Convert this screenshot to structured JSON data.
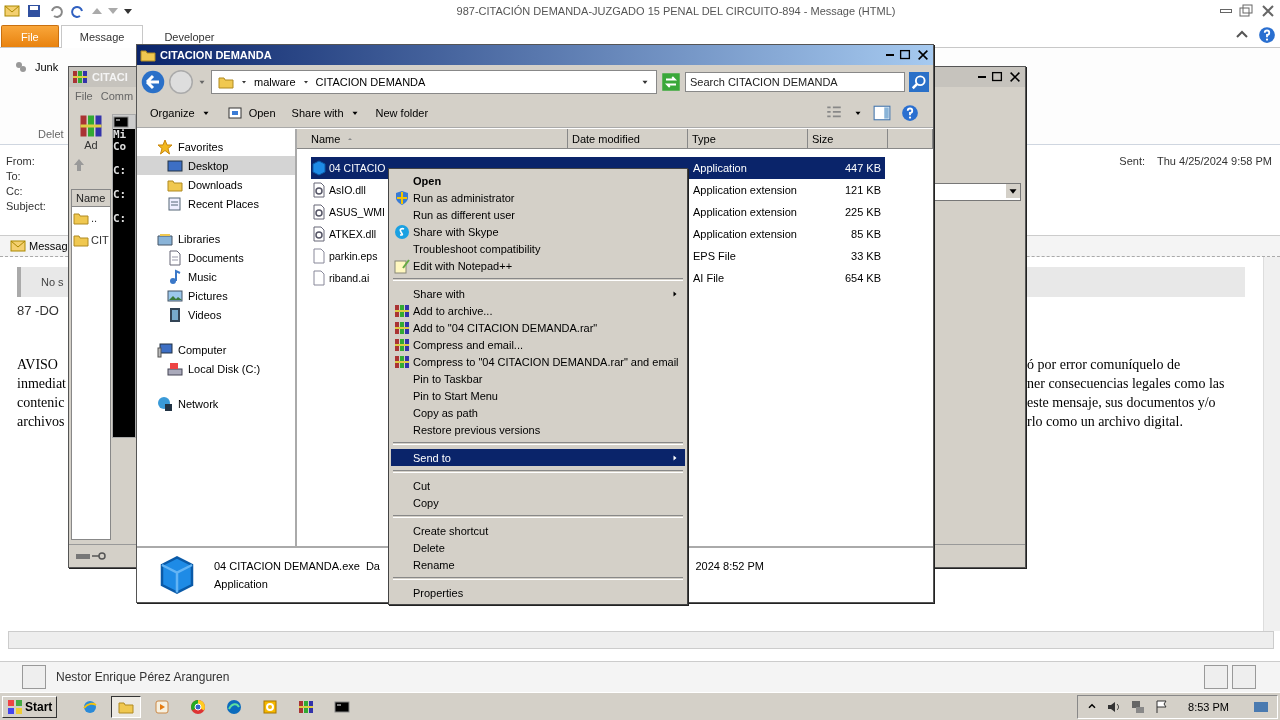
{
  "outlook": {
    "title": "987-CITACIÓN  DEMANDA-JUZGADO 15 PENAL DEL CIRCUITO-894 -  Message (HTML)",
    "tabs": [
      {
        "label": "File",
        "kind": "file",
        "selected": false
      },
      {
        "label": "Message",
        "kind": "tab",
        "selected": true
      },
      {
        "label": "Developer",
        "kind": "tab",
        "selected": false
      }
    ],
    "junk": "Junk",
    "group_label": "Delet",
    "headers": [
      "From:",
      "To:",
      "Cc:",
      "Subject:"
    ],
    "sent_label": "Sent:",
    "sent_value": "Thu 4/25/2024 9:58 PM",
    "attachment": "Messag",
    "info_bar": "No s",
    "first_line": "87 -DO",
    "body_left": [
      "AVISO",
      "inmediat",
      "contenic",
      "archivos"
    ],
    "body_right": [
      "ó por error comuníquelo de",
      "ner consecuencias legales como las",
      "este mensaje, sus documentos y/o",
      "rlo como un archivo digital."
    ],
    "people": "Nestor Enrique Pérez Aranguren"
  },
  "winrar": {
    "title": "CITACI",
    "menu": [
      "File",
      "Comm"
    ],
    "tool": "Ad",
    "column": "Name",
    "rows": [
      "..",
      "CIT"
    ]
  },
  "console": {
    "lines": [
      "Mi",
      "Co",
      "C:",
      "C:",
      "C:"
    ]
  },
  "explorer": {
    "title": "CITACION DEMANDA",
    "path": [
      "malware",
      "CITACION DEMANDA"
    ],
    "search": {
      "placeholder": "Search CITACION DEMANDA"
    },
    "toolbar": [
      {
        "label": "Organize",
        "kind": "menu"
      },
      {
        "label": "Open",
        "kind": "open"
      },
      {
        "label": "Share with",
        "kind": "menu"
      },
      {
        "label": "New folder",
        "kind": "plain"
      }
    ],
    "nav": [
      {
        "label": "Favorites",
        "kind": "star",
        "selected": false,
        "children": [
          {
            "label": "Desktop",
            "kind": "desktop",
            "selected": true
          },
          {
            "label": "Downloads",
            "kind": "folder",
            "selected": false
          },
          {
            "label": "Recent Places",
            "kind": "recent",
            "selected": false
          }
        ]
      },
      {
        "label": "Libraries",
        "kind": "library",
        "selected": false,
        "children": [
          {
            "label": "Documents",
            "kind": "document",
            "selected": false
          },
          {
            "label": "Music",
            "kind": "music",
            "selected": false
          },
          {
            "label": "Pictures",
            "kind": "picture",
            "selected": false
          },
          {
            "label": "Videos",
            "kind": "video",
            "selected": false
          }
        ]
      },
      {
        "label": "Computer",
        "kind": "computer",
        "selected": false,
        "children": [
          {
            "label": "Local Disk (C:)",
            "kind": "disk",
            "selected": false
          }
        ]
      },
      {
        "label": "Network",
        "kind": "network",
        "selected": false
      }
    ],
    "columns": [
      "Name",
      "Date modified",
      "Type",
      "Size"
    ],
    "rows": [
      {
        "name": "04 CITACIO",
        "kind": "exe",
        "type": "Application",
        "size": "447 KB",
        "selected": true
      },
      {
        "name": "AsIO.dll",
        "kind": "dll",
        "type": "Application extension",
        "size": "121 KB",
        "selected": false
      },
      {
        "name": "ASUS_WMI",
        "kind": "dll",
        "type": "Application extension",
        "size": "225 KB",
        "selected": false
      },
      {
        "name": "ATKEX.dll",
        "kind": "dll",
        "type": "Application extension",
        "size": "85 KB",
        "selected": false
      },
      {
        "name": "parkin.eps",
        "kind": "file",
        "type": "EPS File",
        "size": "33 KB",
        "selected": false
      },
      {
        "name": "riband.ai",
        "kind": "file",
        "type": "AI File",
        "size": "654 KB",
        "selected": false
      }
    ],
    "details": {
      "name": "04 CITACION DEMANDA.exe",
      "label": "Da",
      "date": "2024 8:52 PM",
      "type": "Application"
    }
  },
  "menu": [
    {
      "label": "Open",
      "kind": "default",
      "selected": false
    },
    {
      "label": "Run as administrator",
      "kind": "shield",
      "selected": false
    },
    {
      "label": "Run as different user",
      "kind": "item",
      "selected": false
    },
    {
      "label": "Share with Skype",
      "kind": "chat",
      "selected": false
    },
    {
      "label": "Troubleshoot compatibility",
      "kind": "item",
      "selected": false
    },
    {
      "label": "Edit with Notepad++",
      "kind": "notepad",
      "selected": false
    },
    {
      "kind": "separator"
    },
    {
      "label": "Share with",
      "kind": "submenu",
      "selected": false
    },
    {
      "label": "Add to archive...",
      "kind": "archive",
      "selected": false
    },
    {
      "label": "Add to \"04 CITACION DEMANDA.rar\"",
      "kind": "archive",
      "selected": false
    },
    {
      "label": "Compress and email...",
      "kind": "archive",
      "selected": false
    },
    {
      "label": "Compress to \"04 CITACION DEMANDA.rar\" and email",
      "kind": "archive",
      "selected": false
    },
    {
      "label": "Pin to Taskbar",
      "kind": "item",
      "selected": false
    },
    {
      "label": "Pin to Start Menu",
      "kind": "item",
      "selected": false
    },
    {
      "label": "Copy as path",
      "kind": "item",
      "selected": false
    },
    {
      "label": "Restore previous versions",
      "kind": "item",
      "selected": false
    },
    {
      "kind": "separator"
    },
    {
      "label": "Send to",
      "kind": "submenu",
      "selected": true
    },
    {
      "kind": "separator"
    },
    {
      "label": "Cut",
      "kind": "item",
      "selected": false
    },
    {
      "label": "Copy",
      "kind": "item",
      "selected": false
    },
    {
      "kind": "separator"
    },
    {
      "label": "Create shortcut",
      "kind": "item",
      "selected": false
    },
    {
      "label": "Delete",
      "kind": "item",
      "selected": false
    },
    {
      "label": "Rename",
      "kind": "item",
      "selected": false
    },
    {
      "kind": "separator"
    },
    {
      "label": "Properties",
      "kind": "item",
      "selected": false
    }
  ],
  "taskbar": {
    "start": "Start",
    "apps": [
      {
        "kind": "globe",
        "selected": false
      },
      {
        "kind": "folder",
        "selected": true
      },
      {
        "kind": "play",
        "selected": false
      },
      {
        "kind": "ring",
        "selected": false
      },
      {
        "kind": "wave",
        "selected": false
      },
      {
        "kind": "box",
        "selected": false
      },
      {
        "kind": "archive",
        "selected": false
      },
      {
        "kind": "console",
        "selected": false
      }
    ],
    "clock": "8:53 PM"
  }
}
